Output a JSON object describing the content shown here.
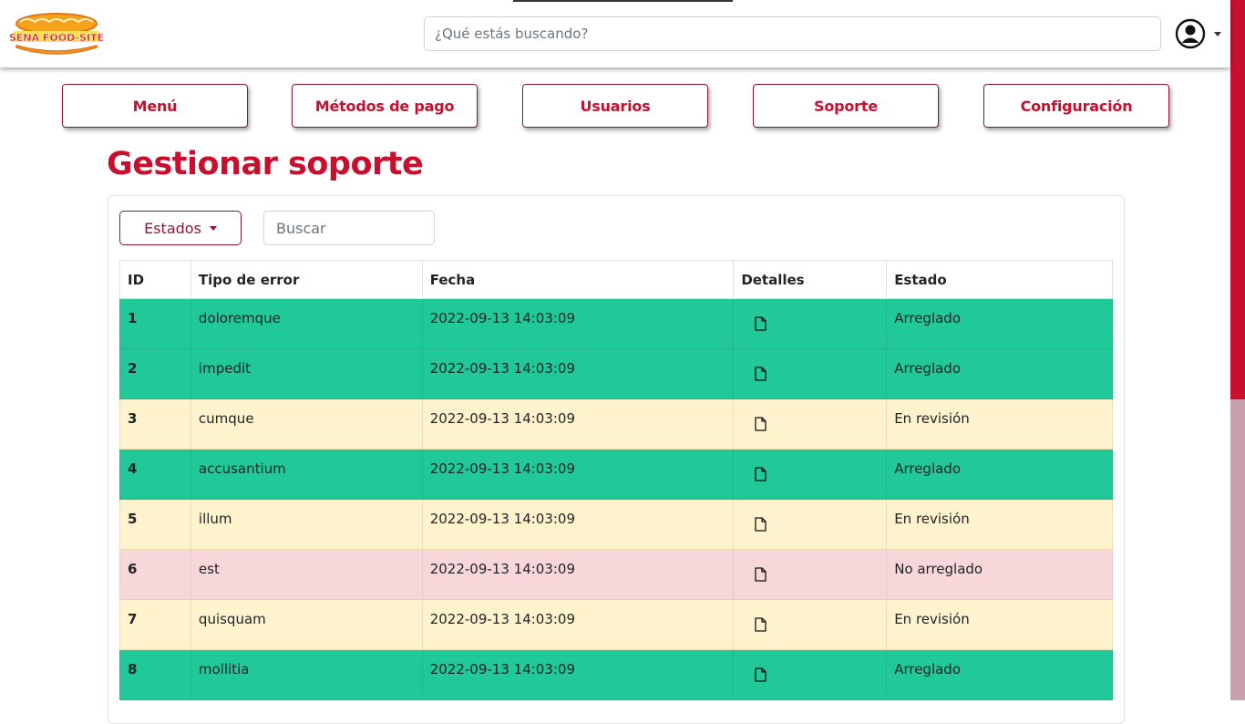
{
  "header": {
    "logo_text": "SENA FOOD-SITE",
    "search_placeholder": "¿Qué estás buscando?",
    "user_icon": "user-circle-icon"
  },
  "nav": {
    "items": [
      {
        "label": "Menú"
      },
      {
        "label": "Métodos de pago"
      },
      {
        "label": "Usuarios"
      },
      {
        "label": "Soporte"
      },
      {
        "label": "Configuración"
      }
    ]
  },
  "main": {
    "title": "Gestionar soporte",
    "filter_label": "Estados",
    "search_placeholder": "Buscar"
  },
  "table": {
    "headers": [
      "ID",
      "Tipo de error",
      "Fecha",
      "Detalles",
      "Estado"
    ],
    "details_icon": "document-icon",
    "rows": [
      {
        "id": "1",
        "tipo": "doloremque",
        "fecha": "2022-09-13 14:03:09",
        "estado": "Arreglado",
        "status": "ok"
      },
      {
        "id": "2",
        "tipo": "impedit",
        "fecha": "2022-09-13 14:03:09",
        "estado": "Arreglado",
        "status": "ok"
      },
      {
        "id": "3",
        "tipo": "cumque",
        "fecha": "2022-09-13 14:03:09",
        "estado": "En revisión",
        "status": "rev"
      },
      {
        "id": "4",
        "tipo": "accusantium",
        "fecha": "2022-09-13 14:03:09",
        "estado": "Arreglado",
        "status": "ok"
      },
      {
        "id": "5",
        "tipo": "illum",
        "fecha": "2022-09-13 14:03:09",
        "estado": "En revisión",
        "status": "rev"
      },
      {
        "id": "6",
        "tipo": "est",
        "fecha": "2022-09-13 14:03:09",
        "estado": "No arreglado",
        "status": "no"
      },
      {
        "id": "7",
        "tipo": "quisquam",
        "fecha": "2022-09-13 14:03:09",
        "estado": "En revisión",
        "status": "rev"
      },
      {
        "id": "8",
        "tipo": "mollitia",
        "fecha": "2022-09-13 14:03:09",
        "estado": "Arreglado",
        "status": "ok"
      }
    ]
  },
  "colors": {
    "brand": "#c8102e",
    "arreglado": "#20c997",
    "en_revision": "#fff3cd",
    "no_arreglado": "#f8d7da"
  }
}
